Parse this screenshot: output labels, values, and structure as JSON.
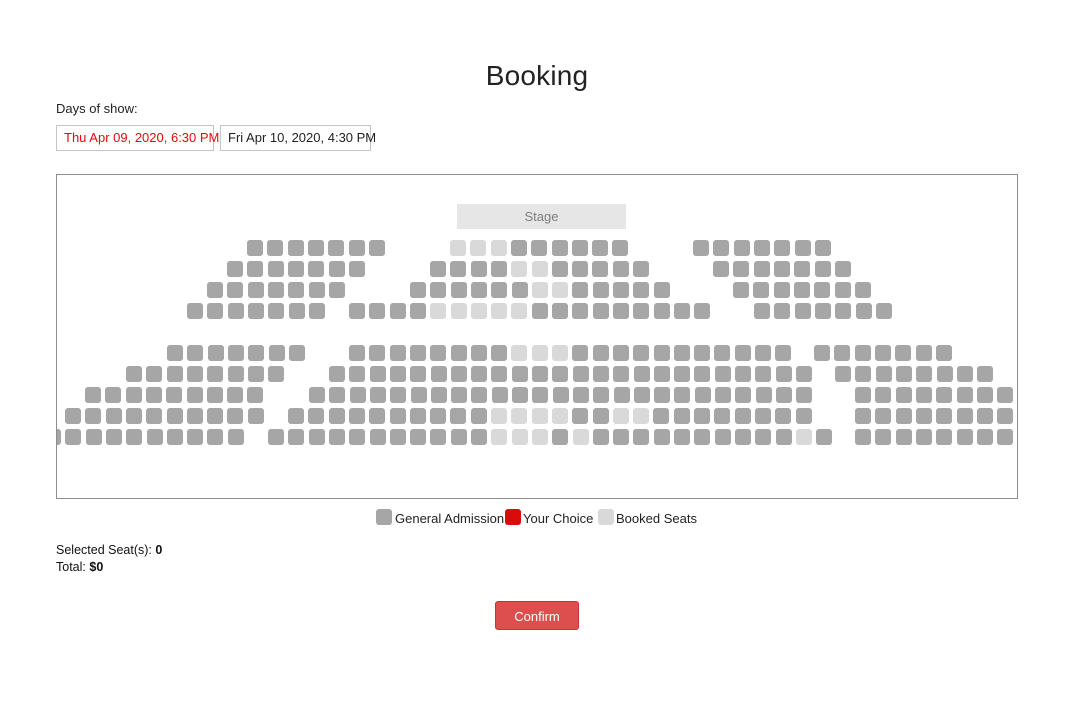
{
  "page": {
    "title": "Booking"
  },
  "days": {
    "label": "Days of show:",
    "options": [
      {
        "label": "Thu Apr 09, 2020, 6:30 PM",
        "selected": true
      },
      {
        "label": "Fri Apr 10, 2020, 4:30 PM",
        "selected": false
      }
    ]
  },
  "seatmap": {
    "stage_label": "Stage",
    "colors": {
      "general": "#a6a6a6",
      "booked": "#d9d9d9",
      "chosen": "#d90b0b"
    }
  },
  "legend": [
    {
      "label": "General Admission",
      "color": "#a6a6a6"
    },
    {
      "label": "Your Choice",
      "color": "#d90b0b"
    },
    {
      "label": "Booked Seats",
      "color": "#d9d9d9"
    }
  ],
  "summary": {
    "selected_label": "Selected Seat(s):",
    "selected_value": "0",
    "total_label": "Total:",
    "total_value": "$0"
  },
  "confirm_label": "Confirm"
}
